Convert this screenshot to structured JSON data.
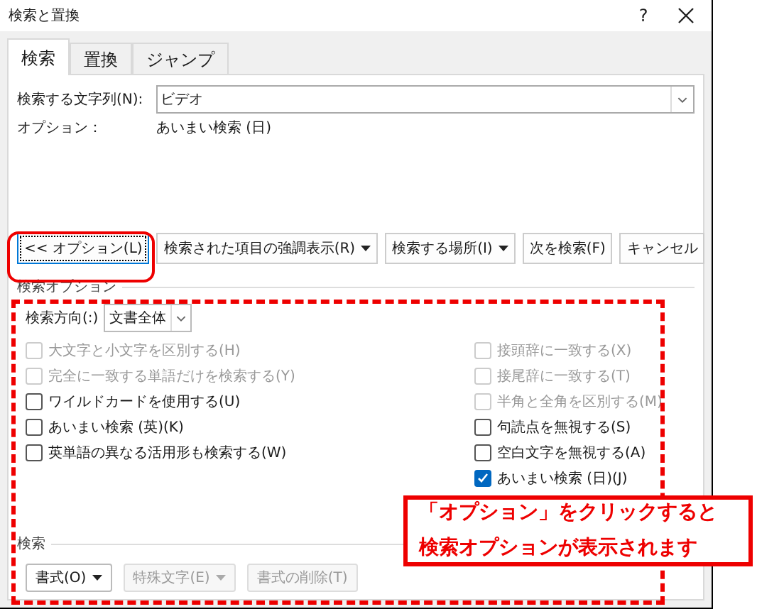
{
  "window": {
    "title": "検索と置換",
    "help": "?"
  },
  "tabs": [
    {
      "label": "検索",
      "selected": true
    },
    {
      "label": "置換",
      "selected": false
    },
    {
      "label": "ジャンプ",
      "selected": false
    }
  ],
  "find_field": {
    "label": "検索する文字列(N):",
    "value": "ビデオ"
  },
  "options_line": {
    "label": "オプション：",
    "value": "あいまい検索 (日)"
  },
  "buttons": [
    {
      "label": "<< オプション(L)",
      "dropdown": false,
      "focused": true
    },
    {
      "label": "検索された項目の強調表示(R)",
      "dropdown": true,
      "focused": false
    },
    {
      "label": "検索する場所(I)",
      "dropdown": true,
      "focused": false
    },
    {
      "label": "次を検索(F)",
      "dropdown": false,
      "focused": false
    },
    {
      "label": "キャンセル",
      "dropdown": false,
      "focused": false
    }
  ],
  "search_options": {
    "title": "検索オプション",
    "direction": {
      "label": "検索方向(:)",
      "value": "文書全体"
    },
    "left_checks": [
      {
        "label": "大文字と小文字を区別する(H)",
        "checked": false,
        "disabled": true
      },
      {
        "label": "完全に一致する単語だけを検索する(Y)",
        "checked": false,
        "disabled": true
      },
      {
        "label": "ワイルドカードを使用する(U)",
        "checked": false,
        "disabled": false
      },
      {
        "label": "あいまい検索 (英)(K)",
        "checked": false,
        "disabled": false
      },
      {
        "label": "英単語の異なる活用形も検索する(W)",
        "checked": false,
        "disabled": false
      }
    ],
    "right_checks": [
      {
        "label": "接頭辞に一致する(X)",
        "checked": false,
        "disabled": true
      },
      {
        "label": "接尾辞に一致する(T)",
        "checked": false,
        "disabled": true
      },
      {
        "label": "半角と全角を区別する(M)",
        "checked": false,
        "disabled": true
      },
      {
        "label": "句読点を無視する(S)",
        "checked": false,
        "disabled": false
      },
      {
        "label": "空白文字を無視する(A)",
        "checked": false,
        "disabled": false
      },
      {
        "label": "あいまい検索 (日)(J)",
        "checked": true,
        "disabled": false
      }
    ]
  },
  "find_section": {
    "title": "検索",
    "buttons": [
      {
        "label": "書式(O)",
        "disabled": false
      },
      {
        "label": "特殊文字(E)",
        "disabled": true
      },
      {
        "label": "書式の削除(T)",
        "disabled": true,
        "dropdown": false
      }
    ]
  },
  "callout": {
    "lines": [
      "「オプション」をクリックすると",
      "検索オプションが表示されます"
    ]
  }
}
